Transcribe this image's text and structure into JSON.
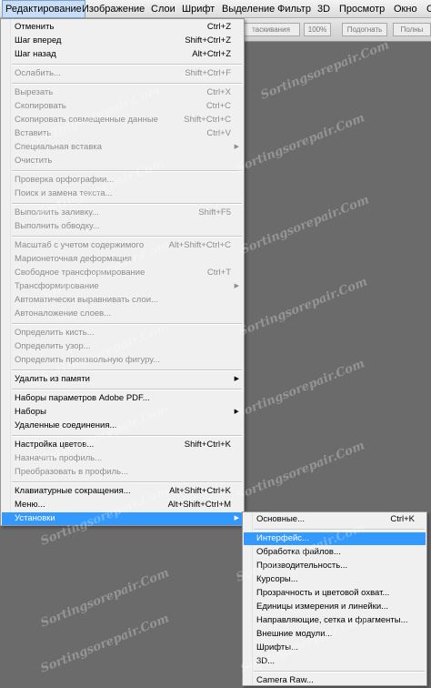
{
  "menubar": [
    {
      "label": "Редактирование",
      "active": true
    },
    {
      "label": "Изображение"
    },
    {
      "label": "Слои"
    },
    {
      "label": "Шрифт"
    },
    {
      "label": "Выделение"
    },
    {
      "label": "Фильтр"
    },
    {
      "label": "3D"
    },
    {
      "label": "Просмотр"
    },
    {
      "label": "Окно"
    },
    {
      "label": "Сп"
    }
  ],
  "options_bar": {
    "items": [
      "таскивания",
      "100%",
      "Подогнать",
      "Полны"
    ]
  },
  "edit_menu": {
    "items": [
      {
        "label": "Отменить",
        "shortcut": "Ctrl+Z"
      },
      {
        "label": "Шаг вперед",
        "shortcut": "Shift+Ctrl+Z"
      },
      {
        "label": "Шаг назад",
        "shortcut": "Alt+Ctrl+Z"
      },
      {
        "sep": true
      },
      {
        "label": "Ослабить...",
        "shortcut": "Shift+Ctrl+F",
        "disabled": true
      },
      {
        "sep": true
      },
      {
        "label": "Вырезать",
        "shortcut": "Ctrl+X",
        "disabled": true
      },
      {
        "label": "Скопировать",
        "shortcut": "Ctrl+C",
        "disabled": true
      },
      {
        "label": "Скопировать совмещенные данные",
        "shortcut": "Shift+Ctrl+C",
        "disabled": true
      },
      {
        "label": "Вставить",
        "shortcut": "Ctrl+V",
        "disabled": true
      },
      {
        "label": "Специальная вставка",
        "submenu": true,
        "disabled": true
      },
      {
        "label": "Очистить",
        "disabled": true
      },
      {
        "sep": true
      },
      {
        "label": "Проверка орфографии...",
        "disabled": true
      },
      {
        "label": "Поиск и замена текста...",
        "disabled": true
      },
      {
        "sep": true
      },
      {
        "label": "Выполнить заливку...",
        "shortcut": "Shift+F5",
        "disabled": true
      },
      {
        "label": "Выполнить обводку...",
        "disabled": true
      },
      {
        "sep": true
      },
      {
        "label": "Масштаб с учетом содержимого",
        "shortcut": "Alt+Shift+Ctrl+C",
        "disabled": true
      },
      {
        "label": "Марионеточная деформация",
        "disabled": true
      },
      {
        "label": "Свободное трансформирование",
        "shortcut": "Ctrl+T",
        "disabled": true
      },
      {
        "label": "Трансформирование",
        "submenu": true,
        "disabled": true
      },
      {
        "label": "Автоматически выравнивать слои...",
        "disabled": true
      },
      {
        "label": "Автоналожение слоев...",
        "disabled": true
      },
      {
        "sep": true
      },
      {
        "label": "Определить кисть...",
        "disabled": true
      },
      {
        "label": "Определить узор...",
        "disabled": true
      },
      {
        "label": "Определить произвольную фигуру...",
        "disabled": true
      },
      {
        "sep": true
      },
      {
        "label": "Удалить из памяти",
        "submenu": true
      },
      {
        "sep": true
      },
      {
        "label": "Наборы параметров Adobe PDF..."
      },
      {
        "label": "Наборы",
        "submenu": true
      },
      {
        "label": "Удаленные соединения..."
      },
      {
        "sep": true
      },
      {
        "label": "Настройка цветов...",
        "shortcut": "Shift+Ctrl+K"
      },
      {
        "label": "Назначить профиль...",
        "disabled": true
      },
      {
        "label": "Преобразовать в профиль...",
        "disabled": true
      },
      {
        "sep": true
      },
      {
        "label": "Клавиатурные сокращения...",
        "shortcut": "Alt+Shift+Ctrl+K"
      },
      {
        "label": "Меню...",
        "shortcut": "Alt+Shift+Ctrl+M"
      },
      {
        "label": "Установки",
        "submenu": true,
        "highlighted": true
      }
    ]
  },
  "prefs_submenu": {
    "items": [
      {
        "label": "Основные...",
        "shortcut": "Ctrl+K"
      },
      {
        "sep": true
      },
      {
        "label": "Интерфейс...",
        "highlighted": true
      },
      {
        "label": "Обработка файлов..."
      },
      {
        "label": "Производительность..."
      },
      {
        "label": "Курсоры..."
      },
      {
        "label": "Прозрачность и цветовой охват..."
      },
      {
        "label": "Единицы измерения и линейки..."
      },
      {
        "label": "Направляющие, сетка и фрагменты..."
      },
      {
        "label": "Внешние модули..."
      },
      {
        "label": "Шрифты..."
      },
      {
        "label": "3D..."
      },
      {
        "sep": true
      },
      {
        "label": "Camera Raw..."
      }
    ]
  },
  "watermark": "Sortingsorepair.Com",
  "colors": {
    "highlight": "#3399ff",
    "menu_bg": "#f0f0f0",
    "workspace": "#6b6b6b"
  }
}
